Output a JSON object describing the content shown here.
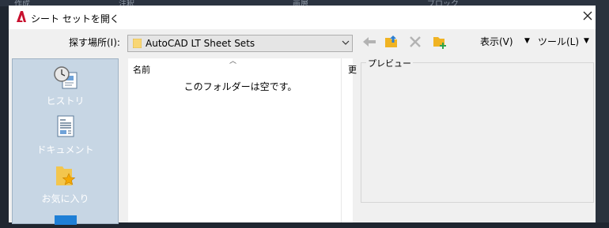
{
  "background": {
    "labels": [
      "作成",
      "注釈",
      "画層",
      "ブロック"
    ]
  },
  "window": {
    "title": "シート セットを開く",
    "close_icon": "close-icon",
    "accent_color": "#c8102e"
  },
  "toolbar": {
    "look_in_label": "探す場所(I):",
    "look_in_value": "AutoCAD LT Sheet Sets",
    "view_menu": "表示(V)",
    "tools_menu": "ツール(L)"
  },
  "places": [
    {
      "label": "ヒストリ",
      "icon": "history-icon"
    },
    {
      "label": "ドキュメント",
      "icon": "documents-icon"
    },
    {
      "label": "お気に入り",
      "icon": "favorites-icon"
    }
  ],
  "file_list": {
    "columns": [
      "名前",
      "更"
    ],
    "empty_message": "このフォルダーは空です。"
  },
  "preview": {
    "label": "プレビュー"
  }
}
